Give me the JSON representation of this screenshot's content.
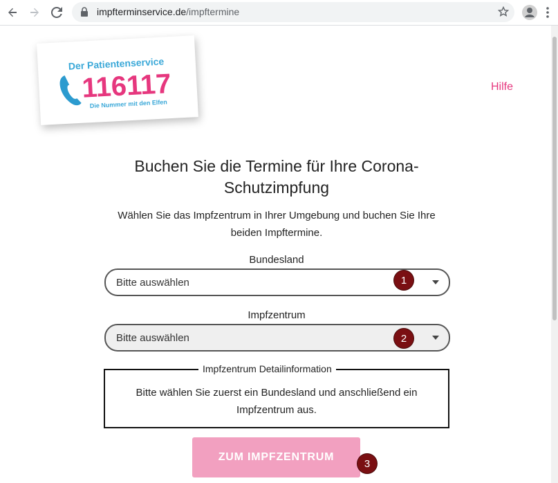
{
  "browser": {
    "url_domain": "impfterminservice.de",
    "url_path": "/impftermine",
    "back_icon": "arrow-left-icon",
    "forward_icon": "arrow-right-icon",
    "reload_icon": "reload-icon",
    "lock_icon": "lock-icon",
    "star_icon": "star-icon",
    "profile_icon": "profile-icon",
    "menu_icon": "kebab-menu-icon"
  },
  "logo": {
    "line1": "Der Patientenservice",
    "number": "116117",
    "tagline": "Die Nummer mit den Elfen",
    "colors": {
      "blue": "#3aa8d8",
      "pink": "#e6377e",
      "phone": "#2c9bcf"
    }
  },
  "header": {
    "help_link": "Hilfe"
  },
  "main": {
    "title": "Buchen Sie die Termine für Ihre Corona-Schutzimpfung",
    "subtitle": "Wählen Sie das Impfzentrum in Ihrer Umgebung und buchen Sie Ihre beiden Impftermine.",
    "state_label": "Bundesland",
    "state_select": "Bitte auswählen",
    "center_label": "Impfzentrum",
    "center_select": "Bitte auswählen",
    "detail_legend": "Impfzentrum Detailinformation",
    "detail_text": "Bitte wählen Sie zuerst ein Bundesland und anschließend ein Impfzentrum aus.",
    "cta_button": "ZUM IMPFZENTRUM"
  },
  "badges": [
    "1",
    "2",
    "3"
  ],
  "colors": {
    "accent": "#e6377e",
    "cta_background": "#f2a0c0",
    "badge": "#7a0f12",
    "disabled_select_bg": "#efefef"
  }
}
